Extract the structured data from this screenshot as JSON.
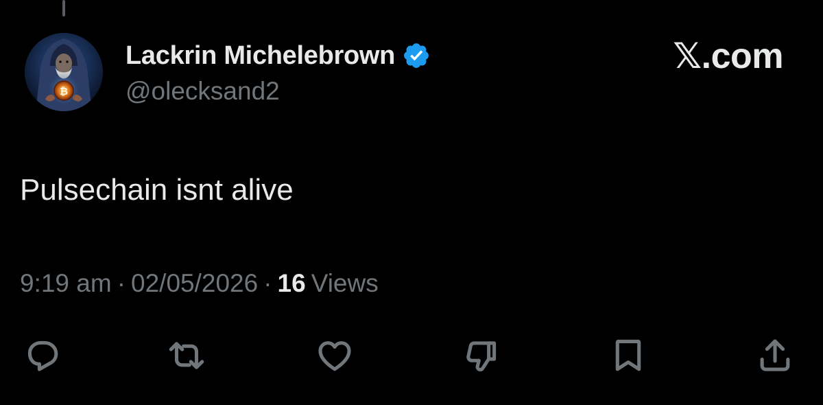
{
  "tweet": {
    "display_name": "Lackrin Michelebrown",
    "handle": "@olecksand2",
    "verified": true,
    "text": "Pulsechain isnt alive",
    "time": "9:19 am",
    "date": "02/05/2026",
    "views_count": "16",
    "views_label": "Views",
    "separator": "·"
  },
  "brand": {
    "label": "𝕏.com"
  },
  "actions": {
    "reply_icon": "reply-icon",
    "repost_icon": "repost-icon",
    "like_icon": "heart-icon",
    "dislike_icon": "thumbs-down-icon",
    "bookmark_icon": "bookmark-icon",
    "share_icon": "share-icon"
  },
  "colors": {
    "background": "#000000",
    "primary_text": "#e7e9ea",
    "secondary_text": "#71767b",
    "verified_badge": "#1d9bf0"
  }
}
